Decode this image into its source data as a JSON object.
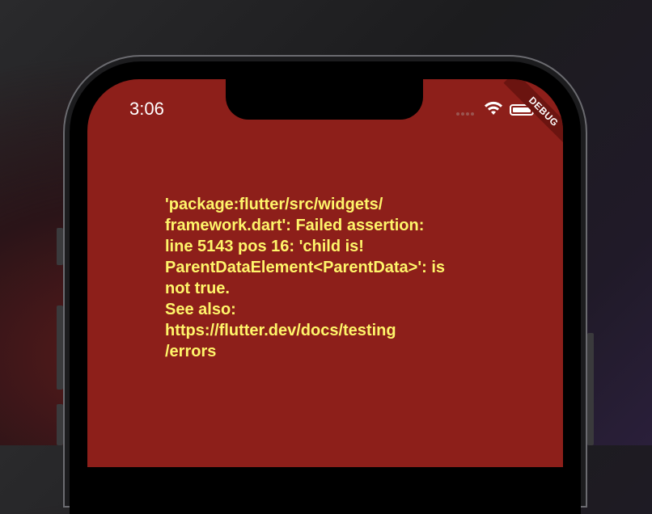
{
  "status_bar": {
    "time": "3:06",
    "icons": [
      "signal-dots-icon",
      "wifi-icon",
      "battery-icon"
    ]
  },
  "debug_banner": {
    "label": "DEBUG"
  },
  "error": {
    "lines": [
      "'package:flutter/src/widgets/",
      "framework.dart': Failed assertion:",
      "line 5143 pos 16: 'child is!",
      "ParentDataElement<ParentData>': is",
      "not true.",
      "See also:",
      "https://flutter.dev/docs/testing",
      "/errors"
    ]
  },
  "colors": {
    "screen_background": "#8d1f1a",
    "error_text": "#fff56a",
    "debug_banner": "#6b1410"
  }
}
